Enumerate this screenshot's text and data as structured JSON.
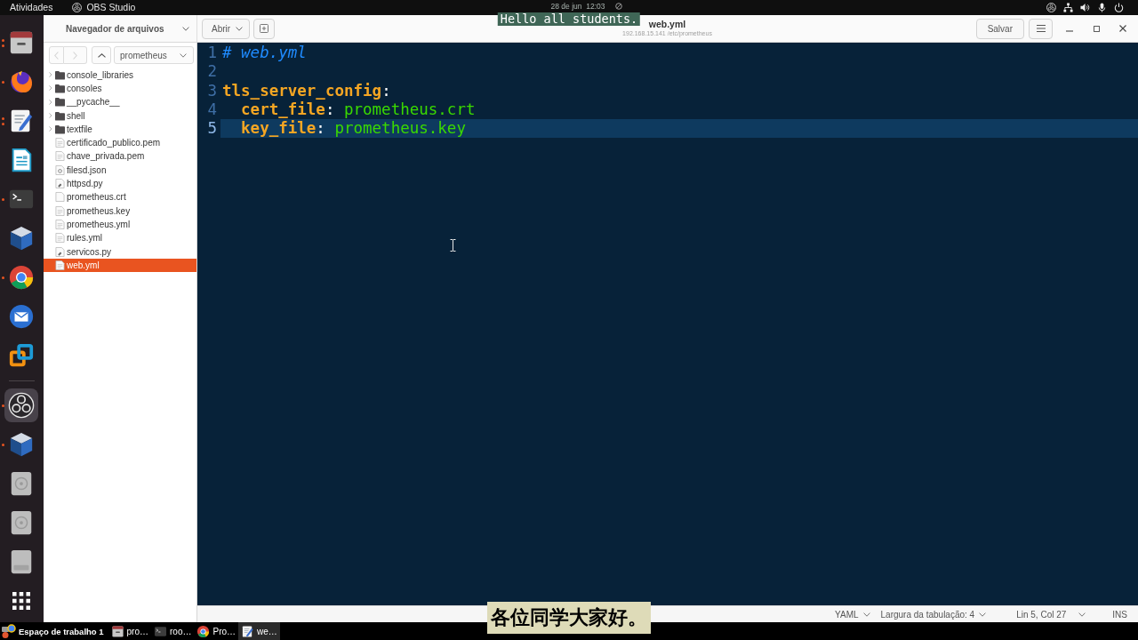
{
  "top_bar": {
    "activities": "Atividades",
    "app_name": "OBS Studio",
    "clock": "28 de jun  12:03"
  },
  "captions": [
    {
      "kind": "top",
      "text": "Hello all students."
    },
    {
      "kind": "bottom",
      "text": "各位同学大家好。"
    }
  ],
  "dock": {
    "favorites": [
      {
        "kind": "cabinet",
        "running": true,
        "multiple": true,
        "selected": false
      },
      {
        "kind": "foxglobe",
        "running": true,
        "multiple": false,
        "selected": false
      },
      {
        "kind": "notepad",
        "running": true,
        "multiple": true,
        "selected": false
      },
      {
        "kind": "document",
        "running": false,
        "multiple": false,
        "selected": false
      },
      {
        "kind": "terminal",
        "running": true,
        "multiple": false,
        "selected": false
      },
      {
        "kind": "cube",
        "running": false,
        "multiple": false,
        "selected": false
      },
      {
        "kind": "ringball",
        "running": true,
        "multiple": false,
        "selected": false
      },
      {
        "kind": "mailglobe",
        "running": false,
        "multiple": false,
        "selected": false
      },
      {
        "kind": "squares",
        "running": false,
        "multiple": false,
        "selected": false
      }
    ],
    "others": [
      {
        "kind": "aperture",
        "running": true,
        "multiple": false,
        "selected": true
      },
      {
        "kind": "cube",
        "running": true,
        "multiple": false,
        "selected": false
      },
      {
        "kind": "disc",
        "running": false,
        "multiple": false,
        "selected": false
      },
      {
        "kind": "disc",
        "running": false,
        "multiple": false,
        "selected": false
      },
      {
        "kind": "drive",
        "running": false,
        "multiple": false,
        "selected": false
      }
    ]
  },
  "header": {
    "panel_title": "Navegador de arquivos",
    "open_button": "Abrir",
    "title": "web.yml",
    "path": "192.168.15.141 /etc/prometheus",
    "save_button": "Salvar"
  },
  "side_panel": {
    "nav": [
      {
        "kind": "back",
        "disabled": true
      },
      {
        "kind": "forward",
        "disabled": true
      },
      {
        "kind": "up",
        "disabled": false
      }
    ],
    "location": "prometheus",
    "folders": [
      {
        "name": "console_libraries",
        "expanded": false,
        "selected": false
      },
      {
        "name": "consoles",
        "expanded": false,
        "selected": false
      },
      {
        "name": "__pycache__",
        "expanded": false,
        "selected": false
      },
      {
        "name": "shell",
        "expanded": false,
        "selected": false
      },
      {
        "name": "textfile",
        "expanded": false,
        "selected": false
      }
    ],
    "files": [
      {
        "name": "certificado_publico.pem",
        "kind": "text",
        "selected": false
      },
      {
        "name": "chave_privada.pem",
        "kind": "text",
        "selected": false
      },
      {
        "name": "filesd.json",
        "kind": "settings",
        "selected": false
      },
      {
        "name": "httpsd.py",
        "kind": "script",
        "selected": false
      },
      {
        "name": "prometheus.crt",
        "kind": "plain",
        "selected": false
      },
      {
        "name": "prometheus.key",
        "kind": "text",
        "selected": false
      },
      {
        "name": "prometheus.yml",
        "kind": "text",
        "selected": false
      },
      {
        "name": "rules.yml",
        "kind": "text",
        "selected": false
      },
      {
        "name": "servicos.py",
        "kind": "script",
        "selected": false
      },
      {
        "name": "web.yml",
        "kind": "text",
        "selected": true
      }
    ]
  },
  "editor": {
    "lines": [
      {
        "number": "1",
        "current": false,
        "tokens": [
          {
            "kind": "comment",
            "text": "# web.yml"
          }
        ]
      },
      {
        "number": "2",
        "current": false
      },
      {
        "number": "3",
        "current": false,
        "tokens": [
          {
            "kind": "key",
            "text": "tls_server_config"
          },
          {
            "kind": "punct",
            "text": ":"
          }
        ],
        "children": [
          {
            "number": "4",
            "current": false,
            "tokens": [
              {
                "kind": "key",
                "text": "cert_file"
              },
              {
                "kind": "punct",
                "text": ":"
              },
              {
                "kind": "value",
                "text": "prometheus.crt"
              }
            ]
          },
          {
            "number": "5",
            "current": true,
            "tokens": [
              {
                "kind": "key",
                "text": "key_file"
              },
              {
                "kind": "punct",
                "text": ":"
              },
              {
                "kind": "value",
                "text": "prometheus.key"
              }
            ]
          }
        ]
      }
    ]
  },
  "status_bar": {
    "language": "YAML",
    "tab_width": "Largura da tabulação: 4",
    "position": "Lin 5, Col 27",
    "mode": "INS"
  },
  "taskbar": {
    "workspace": "Espaço de trabalho 1",
    "tasks": [
      {
        "kind": "cabinet",
        "label": "pro…",
        "selected": false
      },
      {
        "kind": "terminal",
        "label": "roo…",
        "selected": false
      },
      {
        "kind": "ringball",
        "label": "Pro…",
        "selected": false
      },
      {
        "kind": "notepad",
        "label": "we…",
        "selected": true
      }
    ]
  }
}
